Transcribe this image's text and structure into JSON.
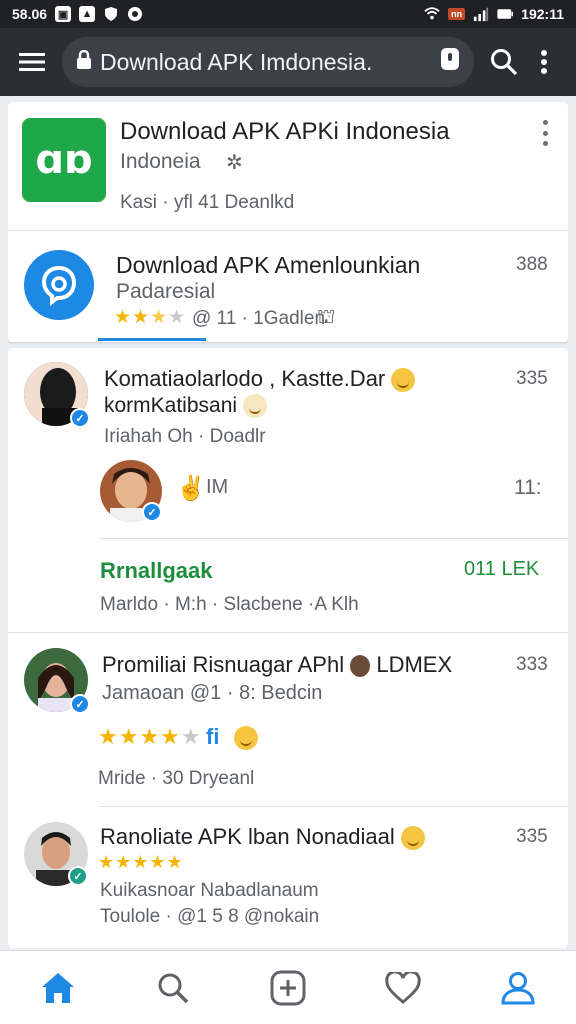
{
  "status_bar": {
    "left_text": "58.06",
    "right_text": "192:11",
    "network_badge": "nn",
    "icons": [
      "android-icon",
      "image-icon",
      "shield-icon",
      "whatsapp-icon",
      "wifi-icon",
      "signal-icon",
      "battery-icon"
    ]
  },
  "toolbar": {
    "url_text": "Download APK Imdonesia.",
    "icons": [
      "menu-icon",
      "lock-icon",
      "tab-switcher-icon",
      "search-icon",
      "more-icon"
    ]
  },
  "apps": [
    {
      "title": "Download APK APKi Indonesia",
      "subtitle": "Indoneia",
      "meta": "Kasi · yfl 41 Deanlkd",
      "icon_glyph": "ɑɒ",
      "color": "#1fa84a"
    },
    {
      "title": "Download APK Amenlounkian",
      "subtitle": "Padaresial",
      "meta": "@ 11 · 1Gadlen",
      "count": "388",
      "rating": 3,
      "color": "#1e88e5"
    }
  ],
  "feed": [
    {
      "title": "Komatiaolarlodo , Kastte.Dar",
      "subtitle": "kormKatibsani",
      "meta": "Iriahah Oh · Doadlr",
      "count": "335"
    },
    {
      "label": "IM",
      "count": "11:"
    },
    {
      "title": "Rrnallgaak",
      "badge": "011 LEK",
      "meta": "Marldo · M:h · Slacbene ·A Klh"
    },
    {
      "title": "Promiliai Risnuagar APhl",
      "title_suffix": "LDMEX",
      "subtitle": "Jamaoan @1 · 8: Bedcin",
      "meta": "Mride · 30 Dryeanl",
      "count": "333",
      "rating": 4,
      "extra": "fi"
    },
    {
      "title": "Ranoliate APK lban Nonadiaal",
      "subtitle": "Kuikasnoar Nabadlanaum",
      "meta": "Toulole · @1 5 8 @nokain",
      "count": "335",
      "rating": 5
    }
  ],
  "bottom_nav": [
    "home-icon",
    "search-icon",
    "add-icon",
    "heart-icon",
    "profile-icon"
  ],
  "colors": {
    "accent": "#1e88e5",
    "app_green": "#1fa84a",
    "positive_green": "#1e8e3e",
    "star": "#f4b400"
  }
}
